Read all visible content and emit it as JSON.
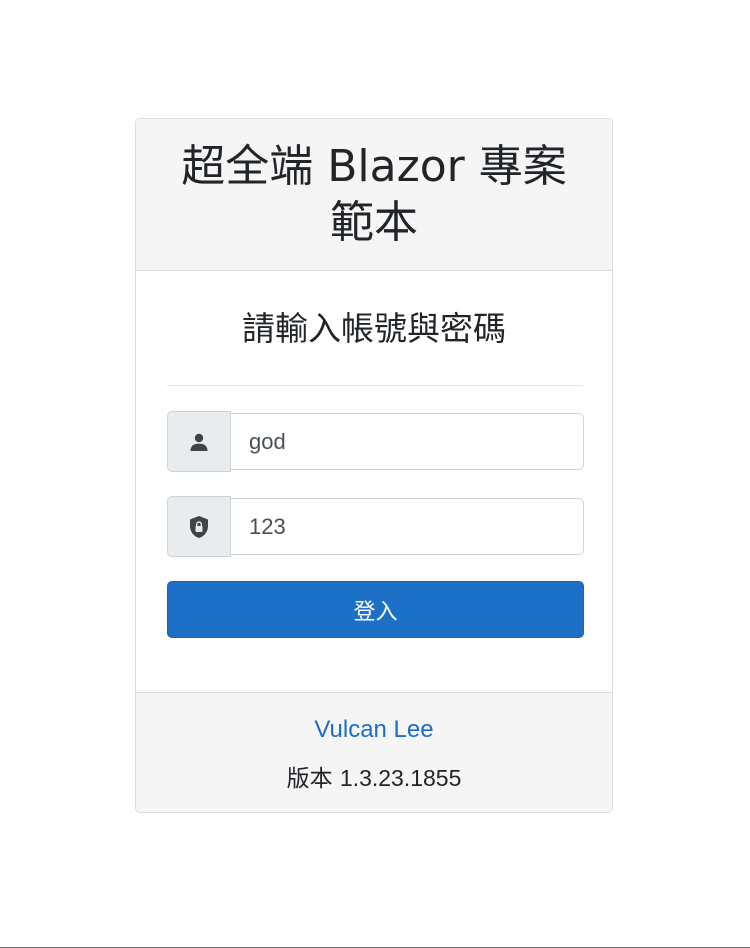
{
  "header": {
    "title_line1": "超全端 Blazor 專案",
    "title_line2": "範本"
  },
  "body": {
    "subtitle": "請輸入帳號與密碼"
  },
  "form": {
    "username": {
      "icon": "person-icon",
      "value": "god"
    },
    "password": {
      "icon": "shield-lock-icon",
      "value": "123"
    },
    "login_label": "登入"
  },
  "footer": {
    "author": "Vulcan Lee",
    "version_label": "版本",
    "version_number": "1.3.23.1855"
  },
  "colors": {
    "primary": "#1c70c5",
    "link": "#1c6dc8",
    "header_bg": "#f5f5f5",
    "addon_bg": "#e9ecef"
  }
}
